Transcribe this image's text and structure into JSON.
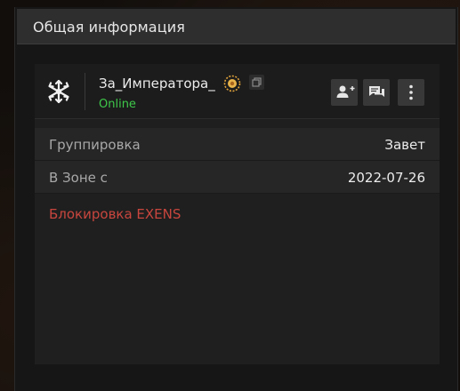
{
  "panel": {
    "title": "Общая информация"
  },
  "profile": {
    "username": "За_Императора_",
    "status": "Online",
    "status_color": "#3ec94a",
    "group_icon": "group-emblem-icon",
    "rank_icon": "rank-badge-icon",
    "copy_icon": "copy-icon",
    "actions": [
      {
        "icon": "add-friend-icon"
      },
      {
        "icon": "message-icon"
      },
      {
        "icon": "more-options-icon"
      }
    ]
  },
  "info": {
    "faction_label": "Группировка",
    "faction_value": "Завет",
    "zone_since_label": "В Зоне с",
    "zone_since_value": "2022-07-26"
  },
  "ban": {
    "text": "Блокировка EXENS",
    "color": "#c8463e"
  }
}
